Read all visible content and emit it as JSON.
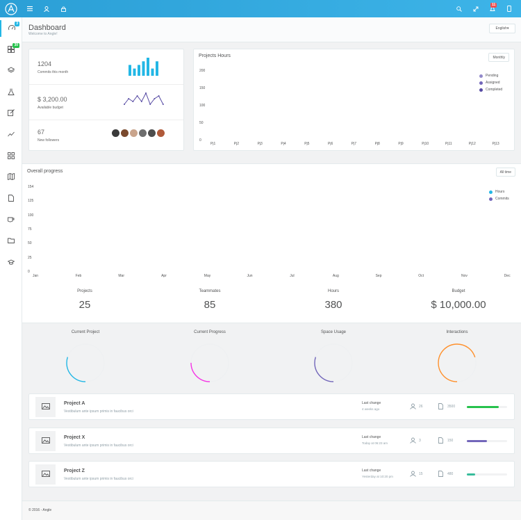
{
  "topbar": {
    "icons": [
      "menu-icon",
      "user-icon",
      "lock-icon",
      "search-icon",
      "expand-icon",
      "notification-icon",
      "tablet-icon"
    ],
    "notification_badge": "11"
  },
  "sidebar": {
    "items": [
      {
        "icon": "speedometer-icon",
        "badge": "3",
        "badge_color": "#23b7e5",
        "active": true
      },
      {
        "icon": "grid-icon",
        "badge": "30",
        "badge_color": "#27c24c"
      },
      {
        "icon": "layers-icon"
      },
      {
        "icon": "chemistry-icon"
      },
      {
        "icon": "pencil-icon"
      },
      {
        "icon": "graph-icon"
      },
      {
        "icon": "apps-icon"
      },
      {
        "icon": "map-icon"
      },
      {
        "icon": "document-icon"
      },
      {
        "icon": "cup-icon"
      },
      {
        "icon": "folder-icon"
      },
      {
        "icon": "graduation-icon"
      }
    ]
  },
  "header": {
    "title": "Dashboard",
    "subtitle": "Welcome to Angle!",
    "language": "English"
  },
  "stats": {
    "commits_value": "1204",
    "commits_label": "Commits this month",
    "budget_value": "$ 3,200.00",
    "budget_label": "Available budget",
    "followers_value": "67",
    "followers_label": "New followers",
    "commits_bars": [
      3,
      2,
      3,
      4,
      5,
      2,
      4
    ],
    "budget_line": [
      3,
      5,
      4,
      6,
      4,
      7,
      3,
      5,
      6,
      3
    ]
  },
  "projects_hours": {
    "title": "Projects Hours",
    "button": "Monthly",
    "legend": [
      {
        "name": "Pending",
        "color": "#9289ca"
      },
      {
        "name": "Assigned",
        "color": "#7266ba"
      },
      {
        "name": "Completed",
        "color": "#564aa3"
      }
    ],
    "chart_data": {
      "type": "bar",
      "categories": [
        "Pj1",
        "Pj2",
        "Pj3",
        "Pj4",
        "Pj5",
        "Pj6",
        "Pj7",
        "Pj8",
        "Pj9",
        "Pj10",
        "Pj11",
        "Pj12",
        "Pj13"
      ],
      "yticks": [
        "200",
        "150",
        "100",
        "50",
        "0"
      ],
      "ylim": [
        0,
        200
      ]
    }
  },
  "overall": {
    "title": "Overall progress",
    "button": "All time",
    "legend": [
      {
        "name": "Hours",
        "color": "#23b7e5"
      },
      {
        "name": "Commits",
        "color": "#7266ba"
      }
    ],
    "chart_data": {
      "type": "line",
      "categories": [
        "Jan",
        "Feb",
        "Mar",
        "Apr",
        "May",
        "Jun",
        "Jul",
        "Aug",
        "Sep",
        "Oct",
        "Nov",
        "Dec"
      ],
      "yticks": [
        "154",
        "125",
        "100",
        "75",
        "50",
        "25",
        "0"
      ],
      "ylim": [
        0,
        154
      ]
    }
  },
  "summary": [
    {
      "label": "Projects",
      "value": "25"
    },
    {
      "label": "Teammates",
      "value": "85"
    },
    {
      "label": "Hours",
      "value": "380"
    },
    {
      "label": "Budget",
      "value": "$ 10,000.00"
    }
  ],
  "donuts": [
    {
      "label": "Current Project",
      "color": "#23b7e5",
      "fraction": 0.3
    },
    {
      "label": "Current Progress",
      "color": "#f532e5",
      "fraction": 0.25
    },
    {
      "label": "Space Usage",
      "color": "#7266ba",
      "fraction": 0.3
    },
    {
      "label": "Interactions",
      "color": "#ff902b",
      "fraction": 0.7
    }
  ],
  "projects": [
    {
      "name": "Project A",
      "desc": "Vestibulum ante ipsum primis in faucibus orci",
      "last_change_label": "Last change",
      "last_change": "4 weeks ago",
      "members": "26",
      "files": "3500",
      "progress": 0.8,
      "color": "#27c24c"
    },
    {
      "name": "Project X",
      "desc": "Vestibulum ante ipsum primis in faucibus orci",
      "last_change_label": "Last change",
      "last_change": "Today at 06:23 am",
      "members": "3",
      "files": "150",
      "progress": 0.5,
      "color": "#7266ba"
    },
    {
      "name": "Project Z",
      "desc": "Vestibulum ante ipsum primis in faucibus orci",
      "last_change_label": "Last change",
      "last_change": "Yesterday at 10:20 pm",
      "members": "15",
      "files": "480",
      "progress": 0.2,
      "color": "#37bc9b"
    }
  ],
  "footer": "© 2016 - Angle"
}
